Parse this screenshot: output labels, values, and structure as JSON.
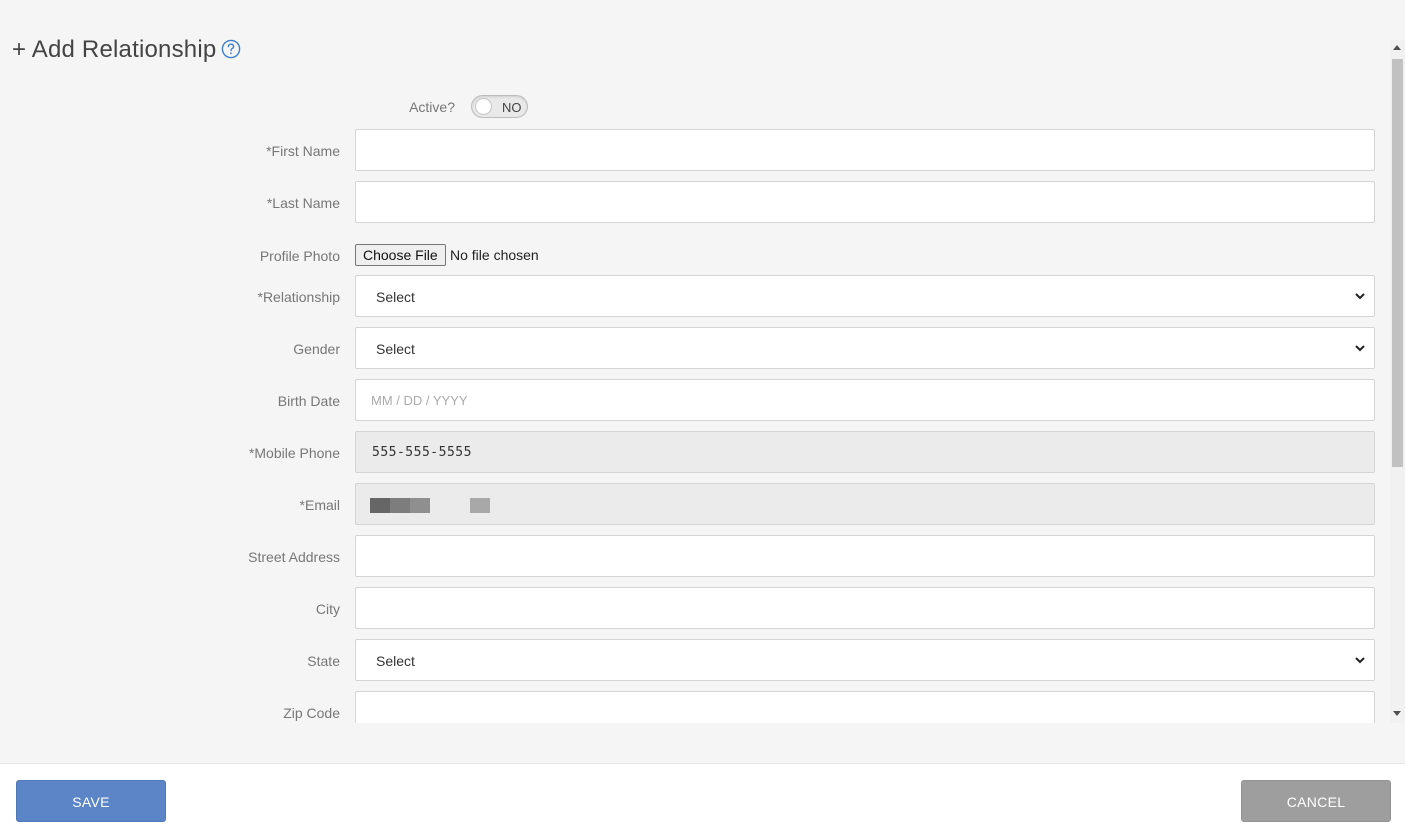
{
  "header": {
    "title": "+ Add Relationship",
    "help_icon": "question-circle-icon"
  },
  "active": {
    "label": "Active?",
    "toggle_text": "NO",
    "value": false
  },
  "fields": {
    "first_name": {
      "label": "*First Name",
      "value": ""
    },
    "last_name": {
      "label": "*Last Name",
      "value": ""
    },
    "profile_photo": {
      "label": "Profile Photo",
      "button": "Choose File",
      "status": "No file chosen"
    },
    "relationship": {
      "label": "*Relationship",
      "selected": "Select"
    },
    "gender": {
      "label": "Gender",
      "selected": "Select"
    },
    "birth_date": {
      "label": "Birth Date",
      "placeholder": "MM / DD / YYYY"
    },
    "mobile_phone": {
      "label": "*Mobile Phone",
      "value": "555-555-5555"
    },
    "email": {
      "label": "*Email",
      "value": ""
    },
    "street_address": {
      "label": "Street Address",
      "value": ""
    },
    "city": {
      "label": "City",
      "value": ""
    },
    "state": {
      "label": "State",
      "selected": "Select"
    },
    "zip_code": {
      "label": "Zip Code",
      "value": ""
    }
  },
  "footer": {
    "save_label": "SAVE",
    "cancel_label": "CANCEL"
  },
  "colors": {
    "save": "#5b85c6",
    "cancel": "#9e9e9e",
    "help": "#3f7fd0"
  }
}
